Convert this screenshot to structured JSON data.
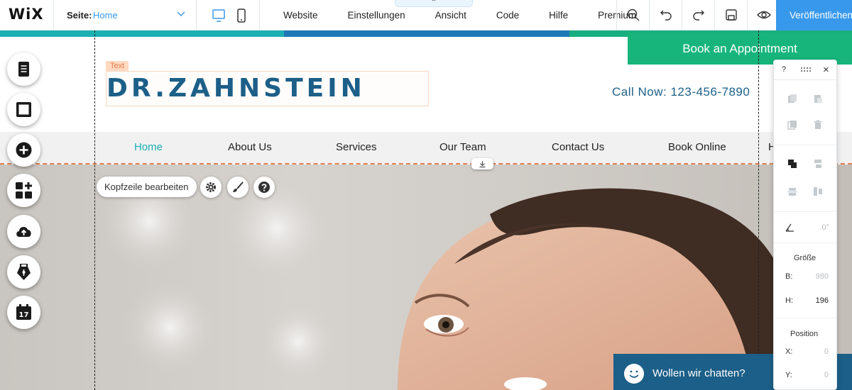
{
  "topbar": {
    "logo": "WiX",
    "page_label": "Seite:",
    "page_value": "Home",
    "collapse_arrow": "⌃",
    "menu": [
      "Website",
      "Einstellungen",
      "Ansicht",
      "Code",
      "Hilfe",
      "Premium"
    ],
    "tools": [
      "zoom-out-icon",
      "undo-icon",
      "redo-icon",
      "save-icon",
      "preview-icon"
    ],
    "publish_label": "Veröffentlichen"
  },
  "site": {
    "text_tag": "Text",
    "logo": "DR.ZAHNSTEIN",
    "call": "Call Now: 123-456-7890",
    "book_button": "Book an Appointment",
    "nav": [
      "Home",
      "About Us",
      "Services",
      "Our Team",
      "Contact Us",
      "Book Online",
      "H"
    ],
    "nav_active": "Home",
    "accent_color": "#1c5f88",
    "green": "#17b57b"
  },
  "editor": {
    "edit_header": "Kopfzeile bearbeiten"
  },
  "left_toolbar": [
    "pages-icon",
    "background-icon",
    "add-icon",
    "apps-icon",
    "upload-icon",
    "pen-icon",
    "calendar-icon"
  ],
  "calendar_day": "17",
  "inspector": {
    "help": "?",
    "close": "×",
    "rotation": "0°",
    "size_title": "Größe",
    "width_label": "B:",
    "width_value": "980",
    "height_label": "H:",
    "height_value": "196",
    "position_title": "Position",
    "x_label": "X:",
    "x_value": "0",
    "y_label": "Y:",
    "y_value": "0"
  },
  "chat": {
    "text": "Wollen wir chatten?"
  }
}
